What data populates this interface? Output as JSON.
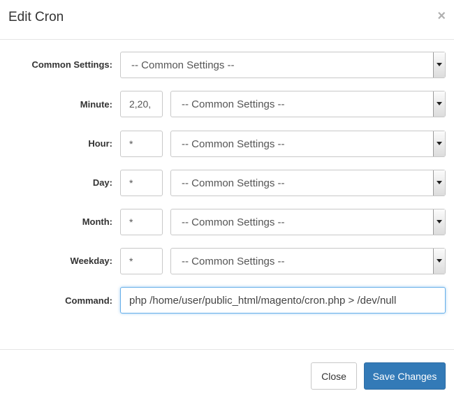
{
  "dialog": {
    "title": "Edit Cron"
  },
  "labels": {
    "common": "Common Settings:",
    "minute": "Minute:",
    "hour": "Hour:",
    "day": "Day:",
    "month": "Month:",
    "weekday": "Weekday:",
    "command": "Command:"
  },
  "fields": {
    "common_select": "-- Common Settings --",
    "minute_value": "2,20,",
    "minute_select": "-- Common Settings --",
    "hour_value": "*",
    "hour_select": "-- Common Settings --",
    "day_value": "*",
    "day_select": "-- Common Settings --",
    "month_value": "*",
    "month_select": "-- Common Settings --",
    "weekday_value": "*",
    "weekday_select": "-- Common Settings --",
    "command_value": "php /home/user/public_html/magento/cron.php > /dev/null"
  },
  "buttons": {
    "close": "Close",
    "save": "Save Changes"
  },
  "icons": {
    "dialog_close": "close-icon",
    "dropdown": "chevron-down-icon"
  }
}
